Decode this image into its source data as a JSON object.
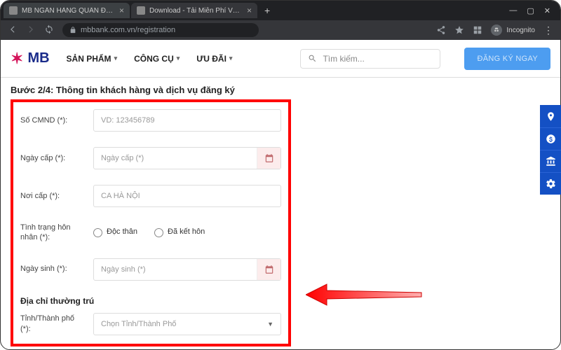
{
  "browser": {
    "tabs": [
      {
        "title": "MB NGÂN HÀNG QUÂN ĐỘI | M"
      },
      {
        "title": "Download - Tải Miễn Phí VN - P"
      }
    ],
    "url_display": "mbbank.com.vn/registration",
    "incognito_label": "Incognito"
  },
  "header": {
    "brand": "MB",
    "nav": [
      "SẢN PHẨM",
      "CÔNG CỤ",
      "ƯU ĐÃI"
    ],
    "search_placeholder": "Tìm kiếm...",
    "cta": "ĐĂNG KÝ NGAY"
  },
  "form": {
    "step_title": "Bước 2/4: Thông tin khách hàng và dịch vụ đăng ký",
    "fields": {
      "id_label": "Số CMND (*):",
      "id_placeholder": "VD: 123456789",
      "issue_date_label": "Ngày cấp (*):",
      "issue_date_placeholder": "Ngày cấp (*)",
      "issue_place_label": "Nơi cấp (*):",
      "issue_place_placeholder": "CA HÀ NỘI",
      "marital_label": "Tình trạng hôn nhân (*):",
      "marital_single": "Độc thân",
      "marital_married": "Đã kết hôn",
      "dob_label": "Ngày sinh (*):",
      "dob_placeholder": "Ngày sinh (*)"
    },
    "address": {
      "section_title": "Địa chỉ thường trú",
      "province_label": "Tỉnh/Thành phố (*):",
      "province_placeholder": "Chọn Tỉnh/Thành Phố"
    }
  }
}
